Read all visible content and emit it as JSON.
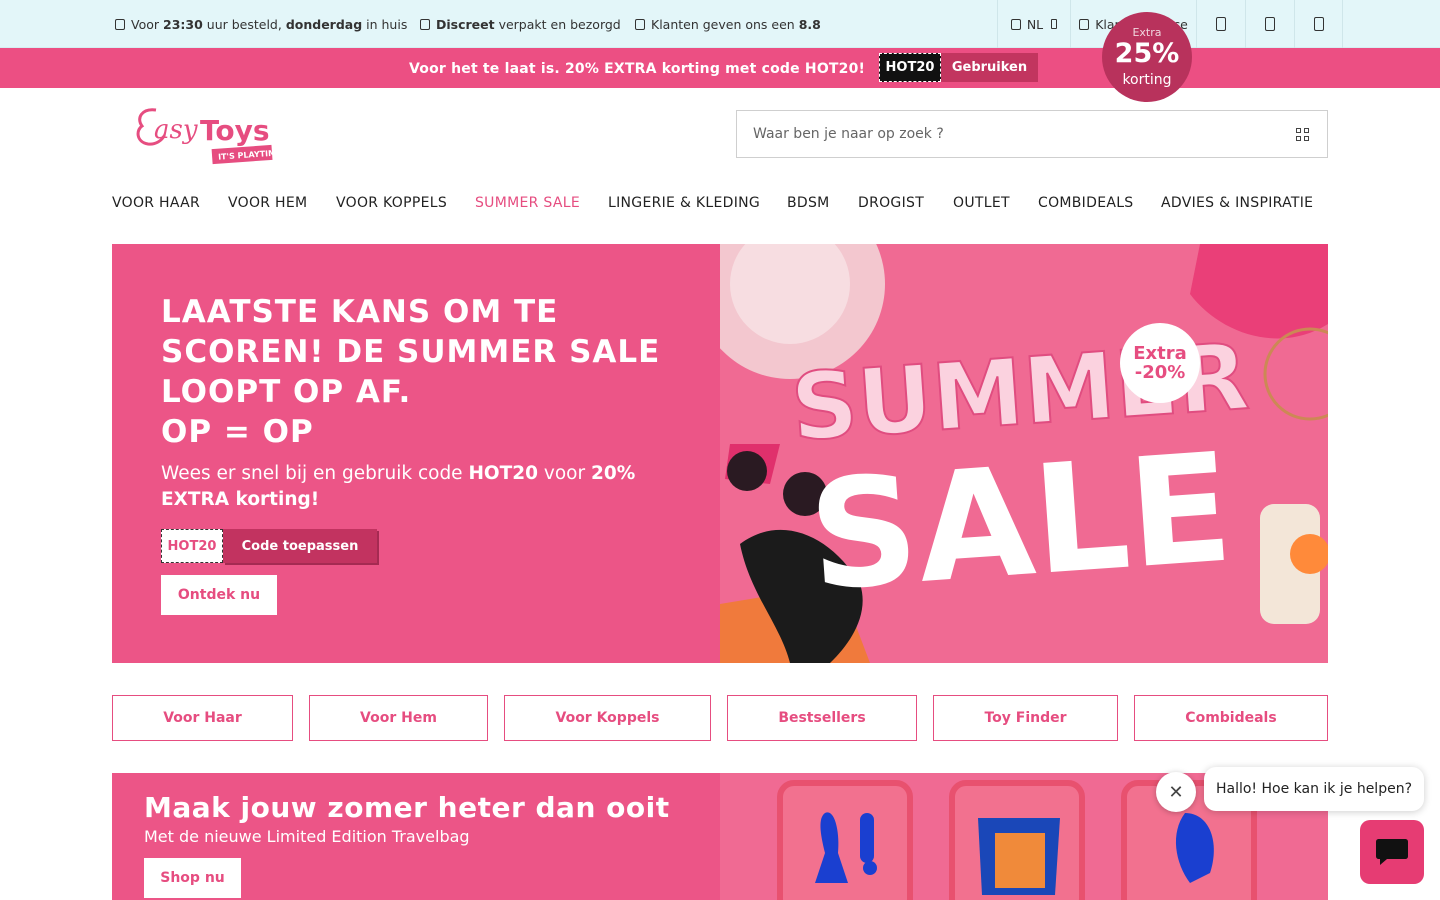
{
  "usp": [
    {
      "pre": "Voor ",
      "b1": "23:30",
      "mid": " uur besteld, ",
      "b2": "donderdag",
      "post": " in huis"
    },
    {
      "b1": "Discreet",
      "post": " verpakt en bezorgd"
    },
    {
      "pre": "Klanten geven ons een ",
      "b1": "8.8"
    }
  ],
  "topbar": {
    "language": "NL",
    "service": "Klantenservice"
  },
  "promo": {
    "text": "Voor het te laat is. 20% EXTRA korting met code HOT20!",
    "code": "HOT20",
    "use_label": "Gebruiken"
  },
  "search": {
    "placeholder": "Waar ben je naar op zoek ?"
  },
  "nav": [
    "VOOR HAAR",
    "VOOR HEM",
    "VOOR KOPPELS",
    "SUMMER SALE",
    "LINGERIE & KLEDING",
    "BDSM",
    "DROGIST",
    "OUTLET",
    "COMBIDEALS",
    "ADVIES & INSPIRATIE"
  ],
  "hero": {
    "title_lines": [
      "LAATSTE KANS OM TE",
      "SCOREN! DE SUMMER SALE",
      "LOOPT OP AF.",
      "OP = OP"
    ],
    "sub_pre": "Wees er snel bij en gebruik code ",
    "sub_code": "HOT20",
    "sub_mid": " voor ",
    "sub_b": "20% EXTRA korting!",
    "code": "HOT20",
    "apply_label": "Code toepassen",
    "cta": "Ontdek nu",
    "image_text": [
      "SUMMER",
      "SALE"
    ],
    "badge": [
      "Extra",
      "-20%"
    ]
  },
  "quick_links": [
    "Voor Haar",
    "Voor Hem",
    "Voor Koppels",
    "Bestsellers",
    "Toy Finder",
    "Combideals"
  ],
  "banner2": {
    "title": "Maak jouw zomer heter dan ooit",
    "subtitle": "Met de nieuwe Limited Edition Travelbag",
    "cta": "Shop nu",
    "badge_pre": "Extra",
    "badge_big": "25%",
    "badge_small": "korting"
  },
  "chat": {
    "message": "Hallo! Hoe kan ik je helpen?"
  },
  "colors": {
    "brand_pink": "#ec5587",
    "dark_pink": "#c23360",
    "usp_bg": "#e3f6f9"
  }
}
